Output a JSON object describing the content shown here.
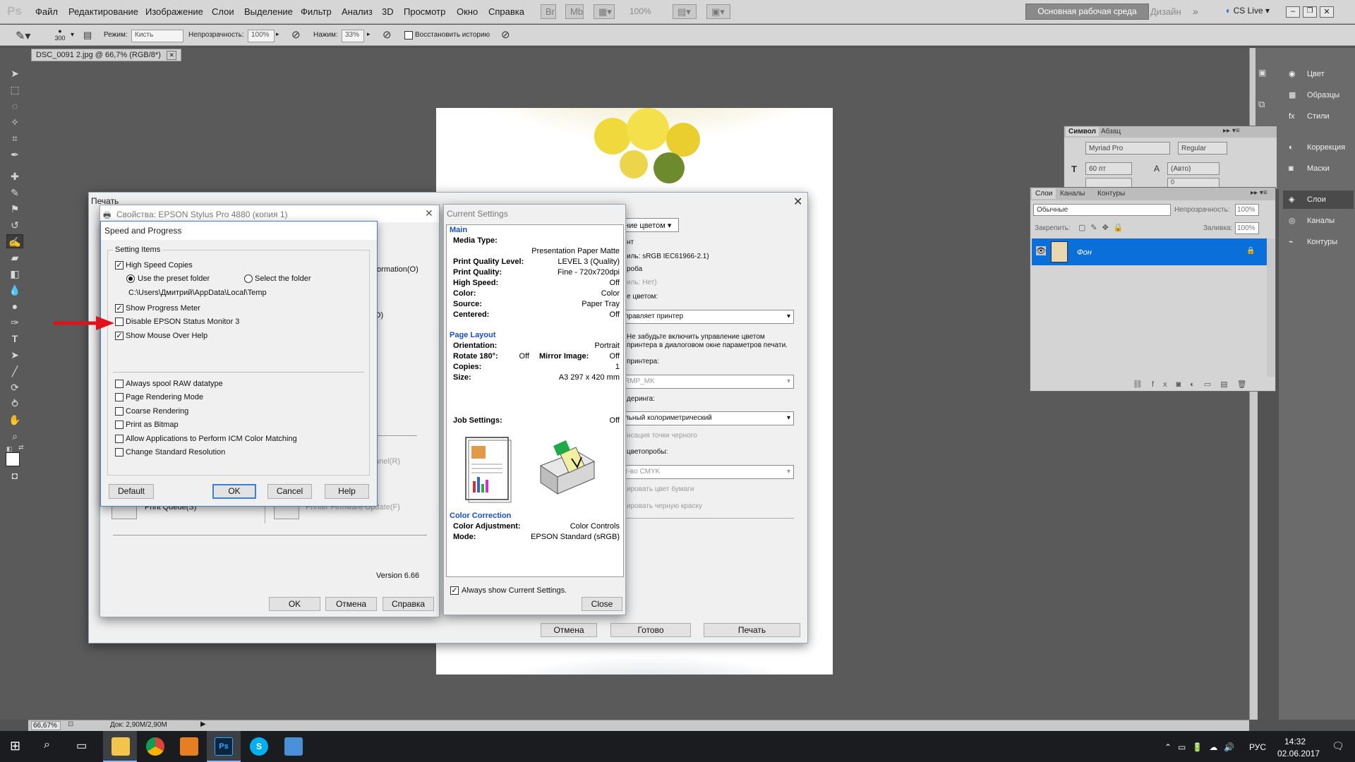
{
  "app": {
    "logo": "Ps",
    "workspace": "Основная рабочая среда",
    "design": "Дизайн",
    "cslive": "CS Live",
    "zoom": "100%"
  },
  "menu": [
    "Файл",
    "Редактирование",
    "Изображение",
    "Слои",
    "Выделение",
    "Фильтр",
    "Анализ",
    "3D",
    "Просмотр",
    "Окно",
    "Справка"
  ],
  "options": {
    "brush_size": "300",
    "mode_label": "Режим:",
    "mode_value": "Кисть",
    "opacity_label": "Непрозрачность:",
    "opacity_value": "100%",
    "flow_label": "Нажим:",
    "flow_value": "33%",
    "history_label": "Восстановить историю"
  },
  "doc_tab": "DSC_0091 2.jpg @ 66,7% (RGB/8*)",
  "status": {
    "zoom": "66,67%",
    "doc": "Док: 2,90M/2,90M"
  },
  "dock": [
    "Цвет",
    "Образцы",
    "Стили",
    "Коррекция",
    "Маски",
    "Слои",
    "Каналы",
    "Контуры"
  ],
  "symbol_panel": {
    "tabs": [
      "Символ",
      "Абзац"
    ],
    "font": "Myriad Pro",
    "style": "Regular",
    "size": "60 пт",
    "leading": "(Авто)",
    "tracking": "0"
  },
  "layers_panel": {
    "tabs": [
      "Слои",
      "Каналы",
      "Контуры"
    ],
    "blend": "Обычные",
    "opacity_label": "Непрозрачность:",
    "opacity": "100%",
    "lock_label": "Закрепить:",
    "fill_label": "Заливка:",
    "fill": "100%",
    "layer_name": "Фон"
  },
  "print_dialog": {
    "title": "Печать",
    "right_fragments": [
      "ние цветом",
      "нт",
      "иль: sRGB IEC61966-2.1)",
      "роба",
      "иль: Нет)",
      "е цветом:",
      "правляет принтер",
      "Не забудьте включить управление цветом",
      "принтера в диалоговом окне параметров печати.",
      "принтера:",
      "RMP_MK",
      "деринга:",
      "льный колориметрический",
      "нсация точки черного",
      "цветопробы:",
      "т-во CMYK",
      "ировать цвет бумаги",
      "ировать черную краску"
    ],
    "buttons": {
      "cancel": "Отмена",
      "done": "Готово",
      "print": "Печать"
    }
  },
  "props_dialog": {
    "title": "Свойства: EPSON Stylus Pro 4880 (копия 1)",
    "fragments": [
      "formation(O)",
      "O)",
      ")",
      "anel(R)",
      "Print Queue(S)",
      "Printer Firmware Update(F)"
    ],
    "version": "Version 6.66",
    "buttons": {
      "ok": "OK",
      "cancel": "Отмена",
      "help": "Справка"
    }
  },
  "speed_dialog": {
    "title": "Speed and Progress",
    "group": "Setting Items",
    "high_speed": "High Speed Copies",
    "preset": "Use the preset folder",
    "select": "Select the folder",
    "path": "C:\\Users\\Дмитрий\\AppData\\Local\\Temp",
    "progress": "Show Progress Meter",
    "disable_monitor": "Disable EPSON Status Monitor 3",
    "mouse_help": "Show Mouse Over Help",
    "spool": "Always spool RAW datatype",
    "page_render": "Page Rendering Mode",
    "coarse": "Coarse Rendering",
    "bitmap": "Print as Bitmap",
    "icm": "Allow Applications to Perform ICM Color Matching",
    "resolution": "Change Standard Resolution",
    "buttons": {
      "default": "Default",
      "ok": "OK",
      "cancel": "Cancel",
      "help": "Help"
    }
  },
  "current_settings": {
    "title": "Current Settings",
    "main": "Main",
    "media_type": "Media Type:",
    "media_value": "Presentation Paper Matte",
    "quality_level": "Print Quality Level:",
    "quality_level_val": "LEVEL 3 (Quality)",
    "quality": "Print Quality:",
    "quality_val": "Fine - 720x720dpi",
    "high_speed": "High Speed:",
    "high_speed_val": "Off",
    "color": "Color:",
    "color_val": "Color",
    "source": "Source:",
    "source_val": "Paper Tray",
    "centered": "Centered:",
    "centered_val": "Off",
    "page_layout": "Page Layout",
    "orientation": "Orientation:",
    "orientation_val": "Portrait",
    "rotate": "Rotate 180°:",
    "rotate_val": "Off",
    "mirror": "Mirror Image:",
    "mirror_val": "Off",
    "copies": "Copies:",
    "copies_val": "1",
    "size": "Size:",
    "size_val": "A3 297 x 420 mm",
    "job": "Job Settings:",
    "job_val": "Off",
    "color_corr": "Color Correction",
    "adj": "Color Adjustment:",
    "adj_val": "Color Controls",
    "mode": "Mode:",
    "mode_val": "EPSON Standard (sRGB)",
    "always_show": "Always show Current Settings.",
    "close": "Close"
  },
  "tray": {
    "time": "14:32",
    "date": "02.06.2017",
    "lang": "РУС"
  },
  "colors": {
    "accent": "#0b6fd9",
    "link": "#1a4fb5",
    "arrow": "#e0131b"
  }
}
